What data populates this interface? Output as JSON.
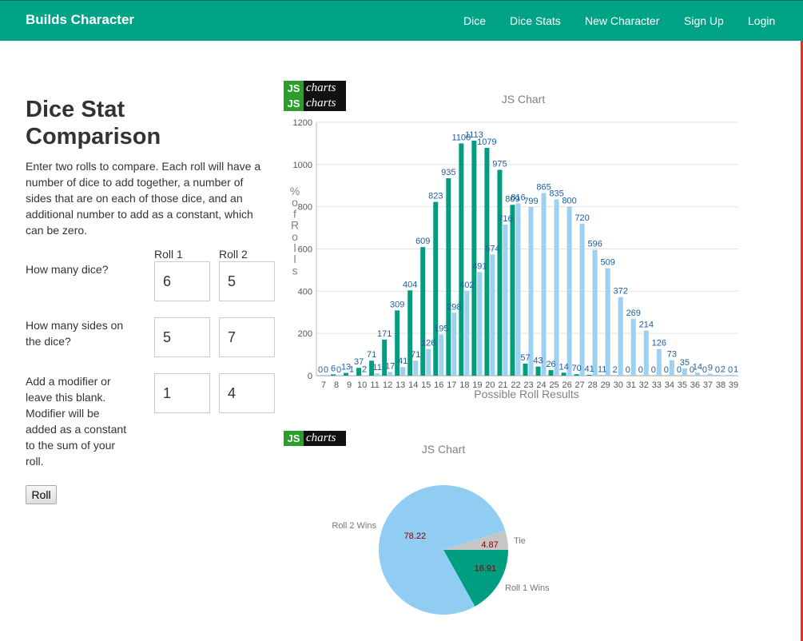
{
  "navbar": {
    "brand": "Builds Character",
    "links": [
      "Dice",
      "Dice Stats",
      "New Character",
      "Sign Up",
      "Login"
    ]
  },
  "page": {
    "title": "Dice Stat Comparison",
    "intro": "Enter two rolls to compare. Each roll will have a number of dice to add together, a number of sides that are on each of those dice, and an additional number to add as a constant, which can be zero.",
    "col1": "Roll 1",
    "col2": "Roll 2",
    "q_dice": "How many dice?",
    "q_sides": "How many sides on the dice?",
    "q_mod": "Add a modifier or leave this blank. Modifier will be added as a constant to the sum of your roll.",
    "roll1": {
      "dice": "6",
      "sides": "5",
      "mod": "1"
    },
    "roll2": {
      "dice": "5",
      "sides": "7",
      "mod": "4"
    },
    "roll_button": "Roll"
  },
  "logo": {
    "js": "JS",
    "charts": "charts"
  },
  "colors": {
    "navbar": "#00a386",
    "roll1": "#009e80",
    "roll2": "#9fd0ef",
    "tie": "#c6c6c6",
    "pie_blue": "#91cdf3"
  },
  "chart_data": [
    {
      "type": "bar",
      "title": "JS Chart",
      "xlabel": "Possible Roll Results",
      "ylabel": "% of Rolls",
      "ylim": [
        0,
        1200
      ],
      "yticks": [
        0,
        200,
        400,
        600,
        800,
        1000,
        1200
      ],
      "grid": true,
      "categories": [
        "7",
        "8",
        "9",
        "10",
        "11",
        "12",
        "13",
        "14",
        "15",
        "16",
        "17",
        "18",
        "19",
        "20",
        "21",
        "22",
        "23",
        "24",
        "25",
        "26",
        "27",
        "28",
        "29",
        "30",
        "31",
        "32",
        "33",
        "34",
        "35",
        "36",
        "37",
        "38",
        "39"
      ],
      "series": [
        {
          "values": [
            0,
            6,
            13,
            37,
            71,
            171,
            309,
            404,
            609,
            823,
            935,
            1100,
            1113,
            1079,
            975,
            809,
            57,
            43,
            26,
            14,
            7,
            4,
            1,
            0,
            0,
            0,
            0,
            0,
            0,
            0,
            0,
            0,
            0
          ],
          "labels": [
            "0",
            "6",
            "13",
            "37",
            "71",
            "171",
            "309",
            "404",
            "609",
            "823",
            "935",
            "1100",
            "1113",
            "1079",
            "975",
            "809",
            "57",
            "43",
            "26",
            "14",
            "70",
            "41",
            "11",
            "2",
            "0",
            "0",
            "0",
            "0",
            "0",
            "0",
            "0",
            "0",
            "0"
          ]
        },
        {
          "values": [
            0,
            0,
            1,
            2,
            11,
            17,
            41,
            71,
            126,
            195,
            298,
            402,
            491,
            574,
            716,
            816,
            799,
            865,
            835,
            800,
            720,
            596,
            509,
            372,
            269,
            214,
            126,
            73,
            35,
            14,
            9,
            2,
            1
          ],
          "labels": [
            "0",
            "0",
            "1",
            "2",
            "11",
            "17",
            "41",
            "71",
            "126",
            "195",
            "298",
            "402",
            "491",
            "574",
            "716",
            "816",
            "799",
            "865",
            "835",
            "800",
            "720",
            "596",
            "509",
            "372",
            "269",
            "214",
            "126",
            "73",
            "35",
            "14",
            "9",
            "2",
            "1"
          ]
        }
      ]
    },
    {
      "type": "pie",
      "title": "JS Chart",
      "slices": [
        {
          "name": "Roll 2 Wins",
          "value": 78.22
        },
        {
          "name": "Tie",
          "value": 4.87
        },
        {
          "name": "Roll 1 Wins",
          "value": 16.91
        }
      ]
    }
  ]
}
